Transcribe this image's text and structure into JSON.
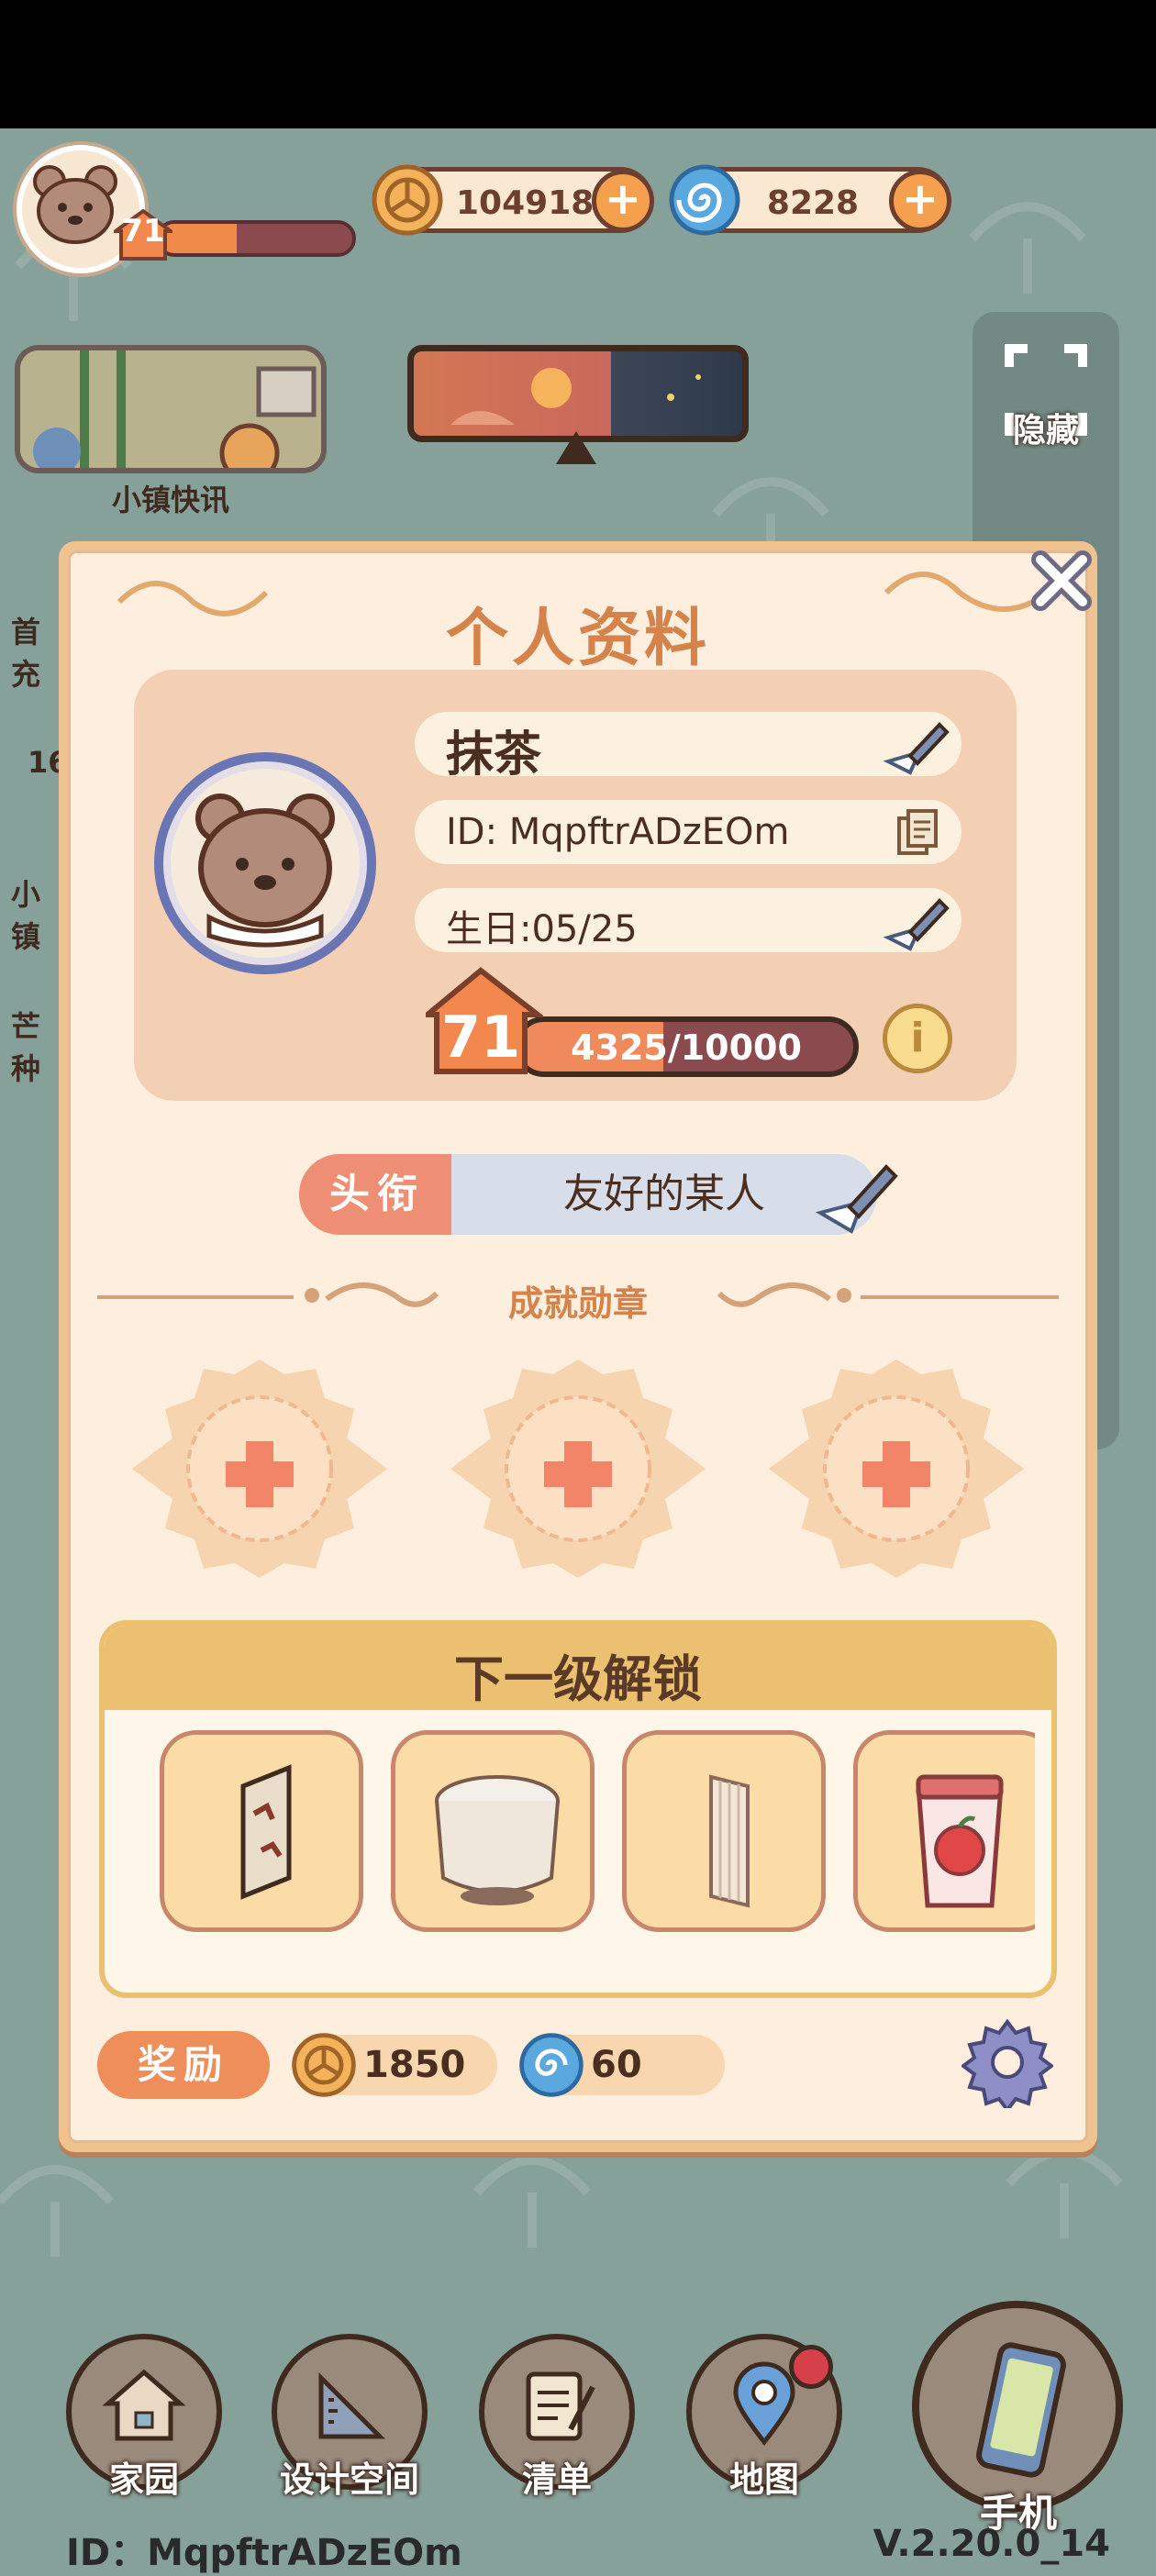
{
  "hud": {
    "player_level": "71",
    "xp_fraction": 0.4,
    "coins": "104918",
    "gems": "8228",
    "news_label": "小镇快讯",
    "hide_label": "隐藏",
    "left_edge_items": [
      "首充",
      "16",
      "小镇",
      "芒种"
    ]
  },
  "profile": {
    "title": "个人资料",
    "name": "抹茶",
    "id_text": "ID: MqpftrADzEOm",
    "birthday_text": "生日:05/25",
    "level": "71",
    "xp_text": "4325/10000",
    "xp_fraction": 0.4325,
    "info_label": "i"
  },
  "honor": {
    "label": "头衔",
    "value": "友好的某人"
  },
  "achievements": {
    "label": "成就勋章",
    "slots": 3
  },
  "unlock": {
    "title": "下一级解锁",
    "items": [
      "painting-icon",
      "round-table-icon",
      "curtain-icon",
      "apple-cup-icon"
    ]
  },
  "reward": {
    "label": "奖励",
    "coins": "1850",
    "gems": "60"
  },
  "nav": {
    "items": [
      {
        "label": "家园",
        "icon": "house-icon"
      },
      {
        "label": "设计空间",
        "icon": "ruler-icon"
      },
      {
        "label": "清单",
        "icon": "list-icon"
      },
      {
        "label": "地图",
        "icon": "map-pin-icon"
      }
    ],
    "phone_label": "手机"
  },
  "footer": {
    "id_text": "ID：MqpftrADzEOm",
    "version": "V.2.20.0_14"
  },
  "colors": {
    "background": "#86a19a",
    "dialog": "#fdeedd",
    "accent_orange": "#d5834a",
    "title_value_bg": "#d7dde9"
  }
}
